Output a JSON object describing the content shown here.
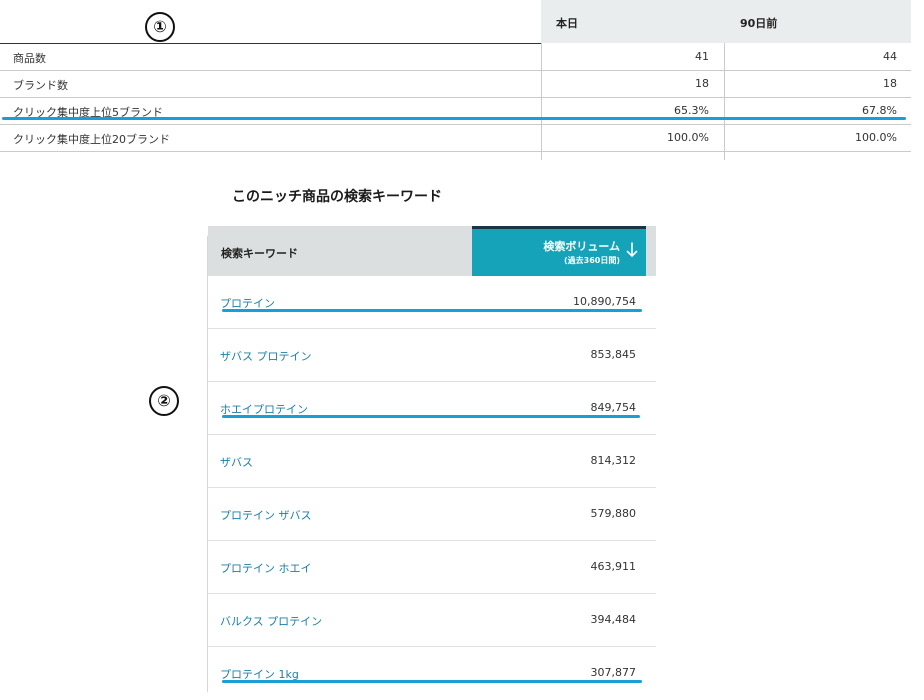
{
  "markers": {
    "one": "①",
    "two": "②"
  },
  "summary_table": {
    "headers": {
      "label": "",
      "today": "本日",
      "ninety_days_ago": "90日前"
    },
    "rows": [
      {
        "label": "商品数",
        "today": "41",
        "ninety_days_ago": "44",
        "highlighted": false
      },
      {
        "label": "ブランド数",
        "today": "18",
        "ninety_days_ago": "18",
        "highlighted": false
      },
      {
        "label": "クリック集中度上位5ブランド",
        "today": "65.3%",
        "ninety_days_ago": "67.8%",
        "highlighted": true
      },
      {
        "label": "クリック集中度上位20ブランド",
        "today": "100.0%",
        "ninety_days_ago": "100.0%",
        "highlighted": false
      }
    ]
  },
  "keyword_section": {
    "title": "このニッチ商品の検索キーワード",
    "headers": {
      "keyword": "検索キーワード",
      "volume": "検索ボリューム",
      "volume_sub": "(過去360日間)",
      "sort_icon": "arrow-down-icon"
    },
    "rows": [
      {
        "keyword": "プロテイン",
        "volume": "10,890,754",
        "highlighted": true
      },
      {
        "keyword": "ザバス プロテイン",
        "volume": "853,845",
        "highlighted": false
      },
      {
        "keyword": "ホエイプロテイン",
        "volume": "849,754",
        "highlighted": true
      },
      {
        "keyword": "ザバス",
        "volume": "814,312",
        "highlighted": false
      },
      {
        "keyword": "プロテイン ザバス",
        "volume": "579,880",
        "highlighted": false
      },
      {
        "keyword": "プロテイン ホエイ",
        "volume": "463,911",
        "highlighted": false
      },
      {
        "keyword": "バルクス プロテイン",
        "volume": "394,484",
        "highlighted": false
      },
      {
        "keyword": "プロテイン 1kg",
        "volume": "307,877",
        "highlighted": true
      }
    ]
  },
  "colors": {
    "highlight": "#1a9ed8",
    "accent_header": "#14a3b8",
    "link": "#1a7fa8"
  }
}
